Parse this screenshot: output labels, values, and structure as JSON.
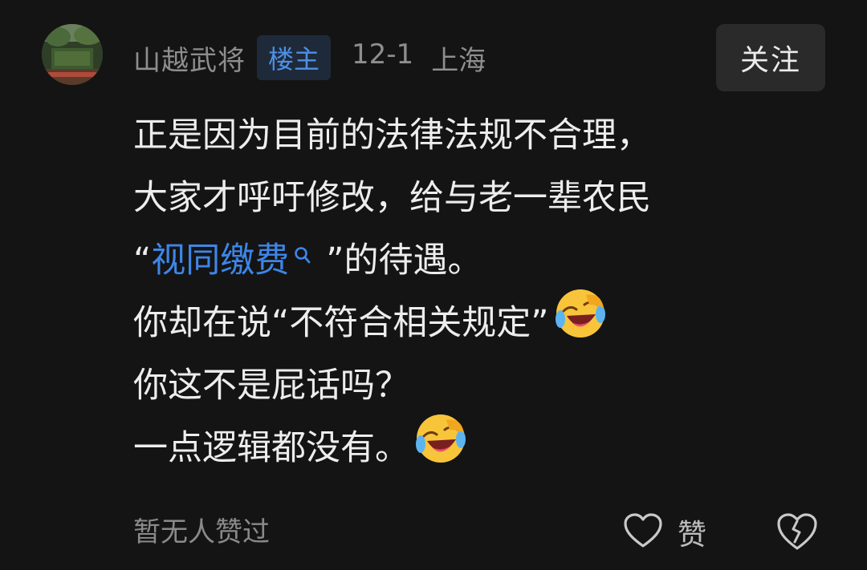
{
  "comment": {
    "username": "山越武将",
    "op_badge": "楼主",
    "date": "12-1",
    "location": "上海",
    "follow_label": "关注",
    "lines": {
      "l1": "正是因为目前的法律法规不合理，",
      "l2": "大家才呼吁修改，给与老一辈农民",
      "l3_open_quote": "“",
      "l3_link": "视同缴费",
      "l3_rest": "”的待遇。",
      "l4": "你却在说“不符合相关规定”",
      "l5": "你这不是屁话吗？",
      "l6": "一点逻辑都没有。"
    },
    "emoji": "laughing-crying-emoji",
    "link_color": "#3d86e8"
  },
  "footer": {
    "likes_text": "暂无人赞过",
    "like_label": "赞"
  },
  "icons": [
    "avatar-image",
    "search-icon",
    "heart-icon",
    "broken-heart-icon"
  ]
}
